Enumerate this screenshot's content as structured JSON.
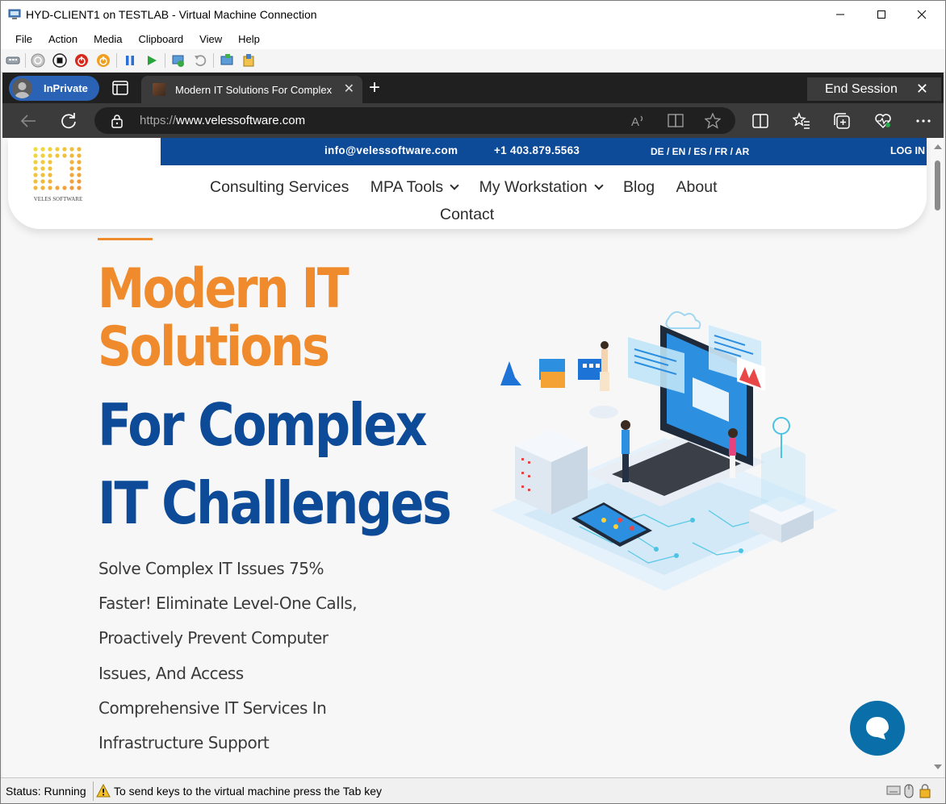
{
  "window": {
    "title": "HYD-CLIENT1 on TESTLAB - Virtual Machine Connection",
    "controls": [
      "minimize-icon",
      "maximize-icon",
      "close-icon"
    ]
  },
  "menu": [
    "File",
    "Action",
    "Media",
    "Clipboard",
    "View",
    "Help"
  ],
  "vm_toolbar": {
    "icons": [
      "ctrl-alt-del-icon",
      "start-icon",
      "turn-off-icon",
      "shutdown-icon",
      "power-icon",
      "pause-icon",
      "resume-icon",
      "checkpoint-icon",
      "revert-icon",
      "enhanced-session-icon",
      "share-icon"
    ]
  },
  "browser": {
    "inprivate_label": "InPrivate",
    "tab_title": "Modern IT Solutions For Complex IT Challenges",
    "end_session_label": "End Session",
    "url_scheme": "https://",
    "url_host": "www.velessoftware.com",
    "accent": "#2a62b5"
  },
  "site": {
    "email": "info@velessoftware.com",
    "phone": "+1 403.879.5563",
    "languages": "DE / EN / ES / FR / AR",
    "login": "LOG IN",
    "logo_text": "VELES SOFTWARE",
    "nav": [
      {
        "label": "Consulting Services",
        "has_dropdown": false
      },
      {
        "label": "MPA Tools",
        "has_dropdown": true
      },
      {
        "label": "My Workstation",
        "has_dropdown": true
      },
      {
        "label": "Blog",
        "has_dropdown": false
      },
      {
        "label": "About",
        "has_dropdown": false
      }
    ],
    "nav_contact": "Contact",
    "colors": {
      "brand_blue": "#0d4a97",
      "brand_orange": "#ef8b2c",
      "chat": "#0a6fa8"
    }
  },
  "hero": {
    "line1": "Modern IT",
    "line2": "Solutions",
    "line3": "For Complex",
    "line4": "IT Challenges",
    "body": [
      "Solve Complex IT Issues 75%",
      "Faster! Eliminate Level-One Calls,",
      "Proactively Prevent Computer",
      "Issues, And Access",
      "Comprehensive IT Services In",
      "Infrastructure Support"
    ]
  },
  "status": {
    "state": "Status: Running",
    "hint": "To send keys to the virtual machine press the Tab key"
  }
}
